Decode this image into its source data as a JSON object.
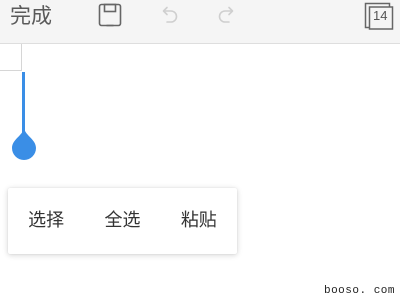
{
  "toolbar": {
    "done_label": "完成",
    "save_icon": "save-icon",
    "undo_icon": "undo-icon",
    "redo_icon": "redo-icon",
    "pages_icon": "pages-icon",
    "page_count": "14",
    "undo_enabled": false,
    "redo_enabled": false
  },
  "context_menu": {
    "items": [
      {
        "label": "选择"
      },
      {
        "label": "全选"
      },
      {
        "label": "粘贴"
      }
    ]
  },
  "colors": {
    "accent": "#3a8ee6",
    "toolbar_bg": "#f5f5f5",
    "disabled_icon": "#cfcfcf"
  },
  "watermark": "booso. com"
}
